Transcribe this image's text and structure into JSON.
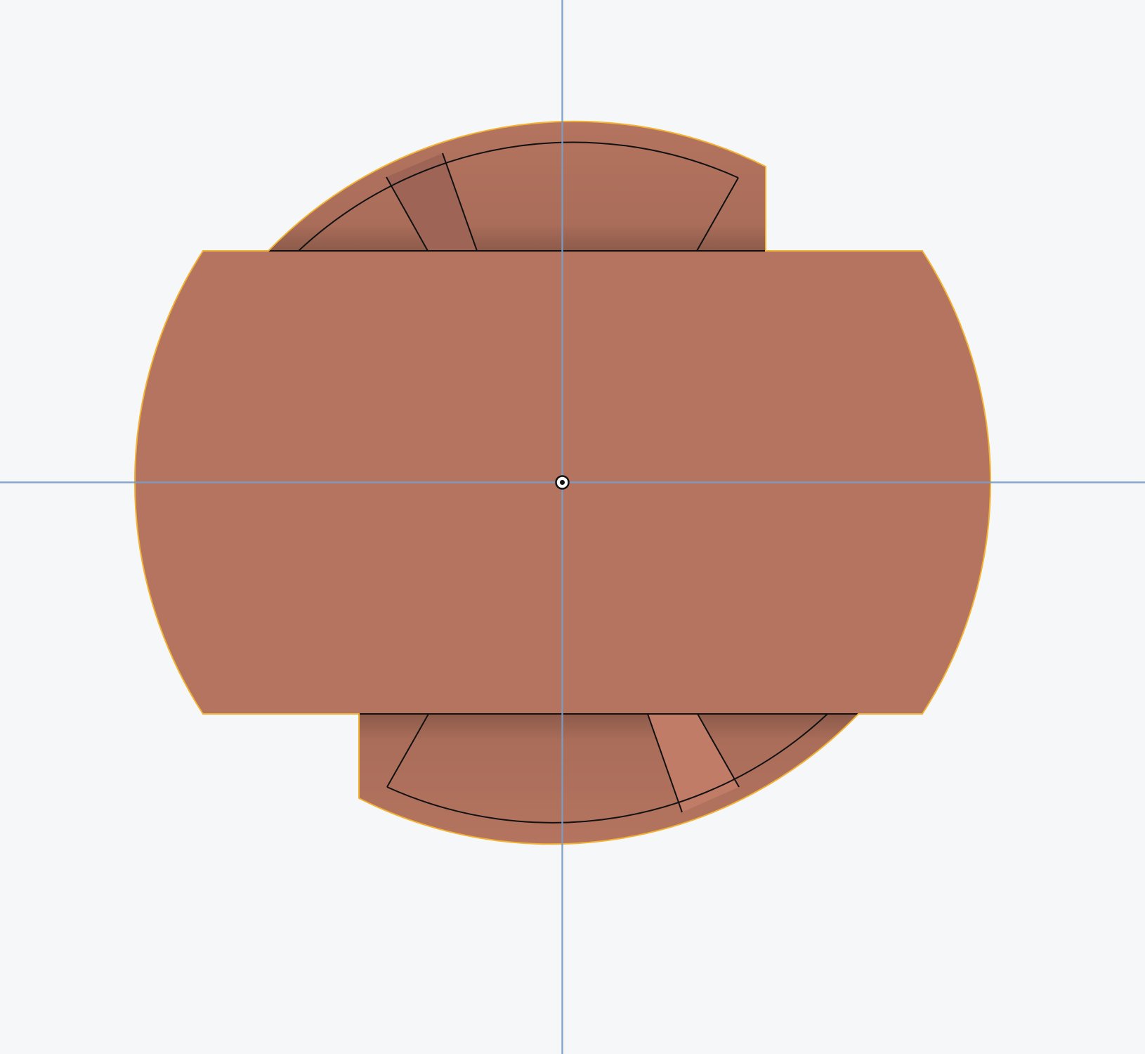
{
  "viewport": {
    "background_color": "#f5f7f9",
    "axis_color": "#7a9cc6",
    "part_color": "#b4745f",
    "part_highlight_color": "#c17c68",
    "part_shadow_color": "#9e6455",
    "selection_outline_color": "#f2b233",
    "edge_color": "#111111"
  },
  "origin": {
    "icon": "origin-point-icon"
  }
}
